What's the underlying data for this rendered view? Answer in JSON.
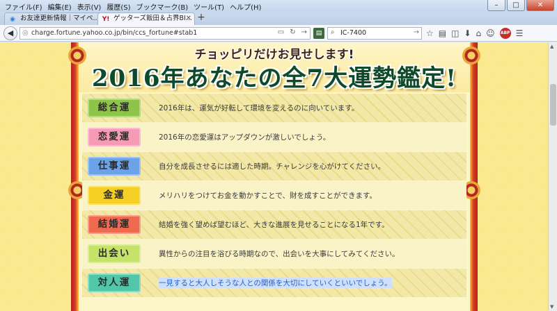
{
  "browser": {
    "menu": [
      "ファイル(F)",
      "編集(E)",
      "表示(V)",
      "履歴(S)",
      "ブックマーク(B)",
      "ツール(T)",
      "ヘルプ(H)"
    ],
    "window_controls": {
      "minimize": "–",
      "maximize": "□",
      "close": "✕"
    },
    "tabs": [
      {
        "title": "お友達更新情報｜マイペ...",
        "favicon": "friends-icon",
        "active": false
      },
      {
        "title": "ゲッターズ飯田＆占界BI...",
        "favicon": "yahoo-icon",
        "favicon_text": "Y!",
        "active": true
      }
    ],
    "new_tab": "+",
    "url": "charge.fortune.yahoo.co.jp/bin/ccs_fortune#stab1",
    "search_value": "IC-7400"
  },
  "page": {
    "subtitle": "チョッピリだけお見せします!",
    "title": "2016年あなたの全7大運勢鑑定!",
    "rows": [
      {
        "label": "総合運",
        "color": "#8fc44a",
        "text": "2016年は、運気が好転して環境を変えるのに向いています。",
        "highlighted": false
      },
      {
        "label": "恋愛運",
        "color": "#f59bb6",
        "text": "2016年の恋愛運はアップダウンが激しいでしょう。",
        "highlighted": false
      },
      {
        "label": "仕事運",
        "color": "#6ba2e8",
        "text": "自分を成長させるには適した時期。チャレンジを心がけてください。",
        "highlighted": false
      },
      {
        "label": "金運",
        "color": "#f5cf24",
        "text": "メリハリをつけてお金を動かすことで、財を成すことができます。",
        "highlighted": false
      },
      {
        "label": "結婚運",
        "color": "#ef6a4e",
        "text": "結婚を強く望めば望むほど、大きな進展を見せることになる1年です。",
        "highlighted": false
      },
      {
        "label": "出会い",
        "color": "#c5e26a",
        "text": "異性からの注目を浴びる時期なので、出会いを大事にしてみてください。",
        "highlighted": false
      },
      {
        "label": "対人運",
        "color": "#52c7a8",
        "text": "一見すると大人しそうな人との関係を大切にしていくといいでしょう。",
        "highlighted": true
      }
    ]
  }
}
